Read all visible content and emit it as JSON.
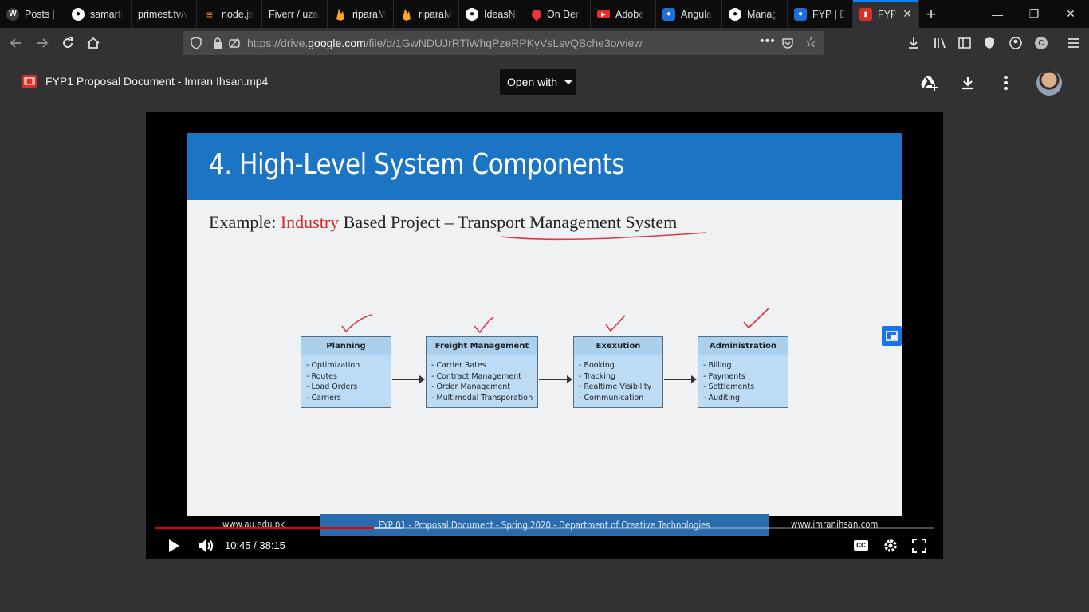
{
  "browser": {
    "tabs": [
      {
        "title": "Posts | I",
        "favicon": "wordpress-icon",
        "color": "#3c3c3c"
      },
      {
        "title": "samartl",
        "favicon": "github-icon",
        "color": "#3c3c3c"
      },
      {
        "title": "primest.tv/v",
        "favicon": "",
        "color": ""
      },
      {
        "title": "node.js",
        "favicon": "stackoverflow-icon",
        "color": "#e87b24"
      },
      {
        "title": "Fiverr / uzai",
        "favicon": "",
        "color": ""
      },
      {
        "title": "riparaM",
        "favicon": "firebase-icon",
        "color": "#f6a623"
      },
      {
        "title": "riparaM",
        "favicon": "firebase-icon",
        "color": "#f6a623"
      },
      {
        "title": "IdeasNF",
        "favicon": "github-icon",
        "color": "#3c3c3c"
      },
      {
        "title": "On Den",
        "favicon": "location-pin-icon",
        "color": "#e53935"
      },
      {
        "title": "Adobe",
        "favicon": "youtube-icon",
        "color": "#e52d27"
      },
      {
        "title": "Angula",
        "favicon": "classroom-icon",
        "color": "#1e6fd9"
      },
      {
        "title": "Manag",
        "favicon": "github-icon",
        "color": "#3c3c3c"
      },
      {
        "title": "FYP | D",
        "favicon": "classroom-icon",
        "color": "#1e6fd9"
      },
      {
        "title": "FYP",
        "favicon": "video-file-icon",
        "color": "#d93025"
      }
    ],
    "url_prefix": "https://drive.",
    "url_host": "google.com",
    "url_path": "/file/d/1GwNDUJrRTlWhqPzeRPKyVsLsvQBche3o/view"
  },
  "drive": {
    "file_name": "FYP1 Proposal Document - Imran Ihsan.mp4",
    "open_with_label": "Open with"
  },
  "slide": {
    "title": "4. High-Level System Components",
    "subtitle_prefix": "Example: ",
    "subtitle_highlight": "Industry",
    "subtitle_mid": " Based Project – ",
    "subtitle_tail": "Transport Management System",
    "components": [
      {
        "name": "Planning",
        "items": [
          "- Optimization",
          "- Routes",
          "- Load Orders",
          "- Carriers"
        ]
      },
      {
        "name": "Freight Management",
        "items": [
          "- Carrier Rates",
          "- Contract Management",
          "- Order Management",
          "- Multimodal Transporation"
        ]
      },
      {
        "name": "Exexution",
        "items": [
          "- Booking",
          "- Tracking",
          "- Realtime Visibility",
          "- Communication"
        ]
      },
      {
        "name": "Administration",
        "items": [
          "- Billing",
          "- Payments",
          "- Settlements",
          "- Auditing"
        ]
      }
    ],
    "footer_left": "www.au.edu.pk",
    "footer_mid": "FYP 01 - Proposal Document - Spring 2020 - Department of Creative Technologies",
    "footer_right": "www.imranihsan.com"
  },
  "player": {
    "time_current": "10:45",
    "time_total": "38:15",
    "time_display": "10:45 / 38:15",
    "progress_fraction": 0.281,
    "buffer_fraction": 0.318,
    "cc_label": "CC"
  },
  "colors": {
    "accent": "#0a84ff",
    "slide_header": "#1b75c4",
    "progress": "#ee0000",
    "annotation": "#e0344a"
  }
}
